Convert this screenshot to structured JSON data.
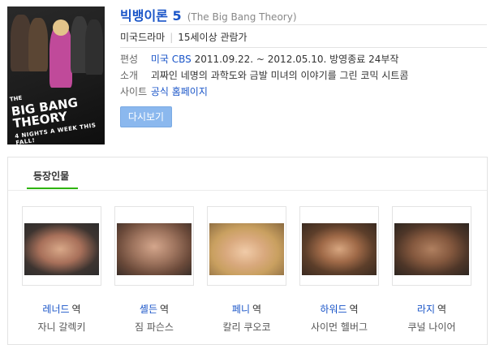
{
  "show": {
    "title": "빅뱅이론 5",
    "title_en": "(The Big Bang Theory)",
    "genre": "미국드라마",
    "rating": "15세이상 관람가",
    "poster": {
      "logo_text": "BIG BANG THEORY",
      "logo_prefix": "THE",
      "tagline": "4 NIGHTS A WEEK THIS FALL!"
    }
  },
  "info": {
    "broadcast_label": "편성",
    "broadcast_channel": "미국 CBS",
    "broadcast_detail": "2011.09.22. ~ 2012.05.10. 방영종료 24부작",
    "synopsis_label": "소개",
    "synopsis": "괴짜인 네명의 과학도와 금발 미녀의 이야기를 그린 코믹 시트콤",
    "site_label": "사이트",
    "site_link": "공식 홈페이지"
  },
  "replay_button": "다시보기",
  "cast_tab": "등장인물",
  "cast": [
    {
      "role": "레너드",
      "suffix": "역",
      "actor": "자니 갈렉키"
    },
    {
      "role": "셸든",
      "suffix": "역",
      "actor": "짐 파슨스"
    },
    {
      "role": "페니",
      "suffix": "역",
      "actor": "칼리 쿠오코"
    },
    {
      "role": "하워드",
      "suffix": "역",
      "actor": "사이먼 헬버그"
    },
    {
      "role": "라지",
      "suffix": "역",
      "actor": "쿠널 나이어"
    }
  ]
}
